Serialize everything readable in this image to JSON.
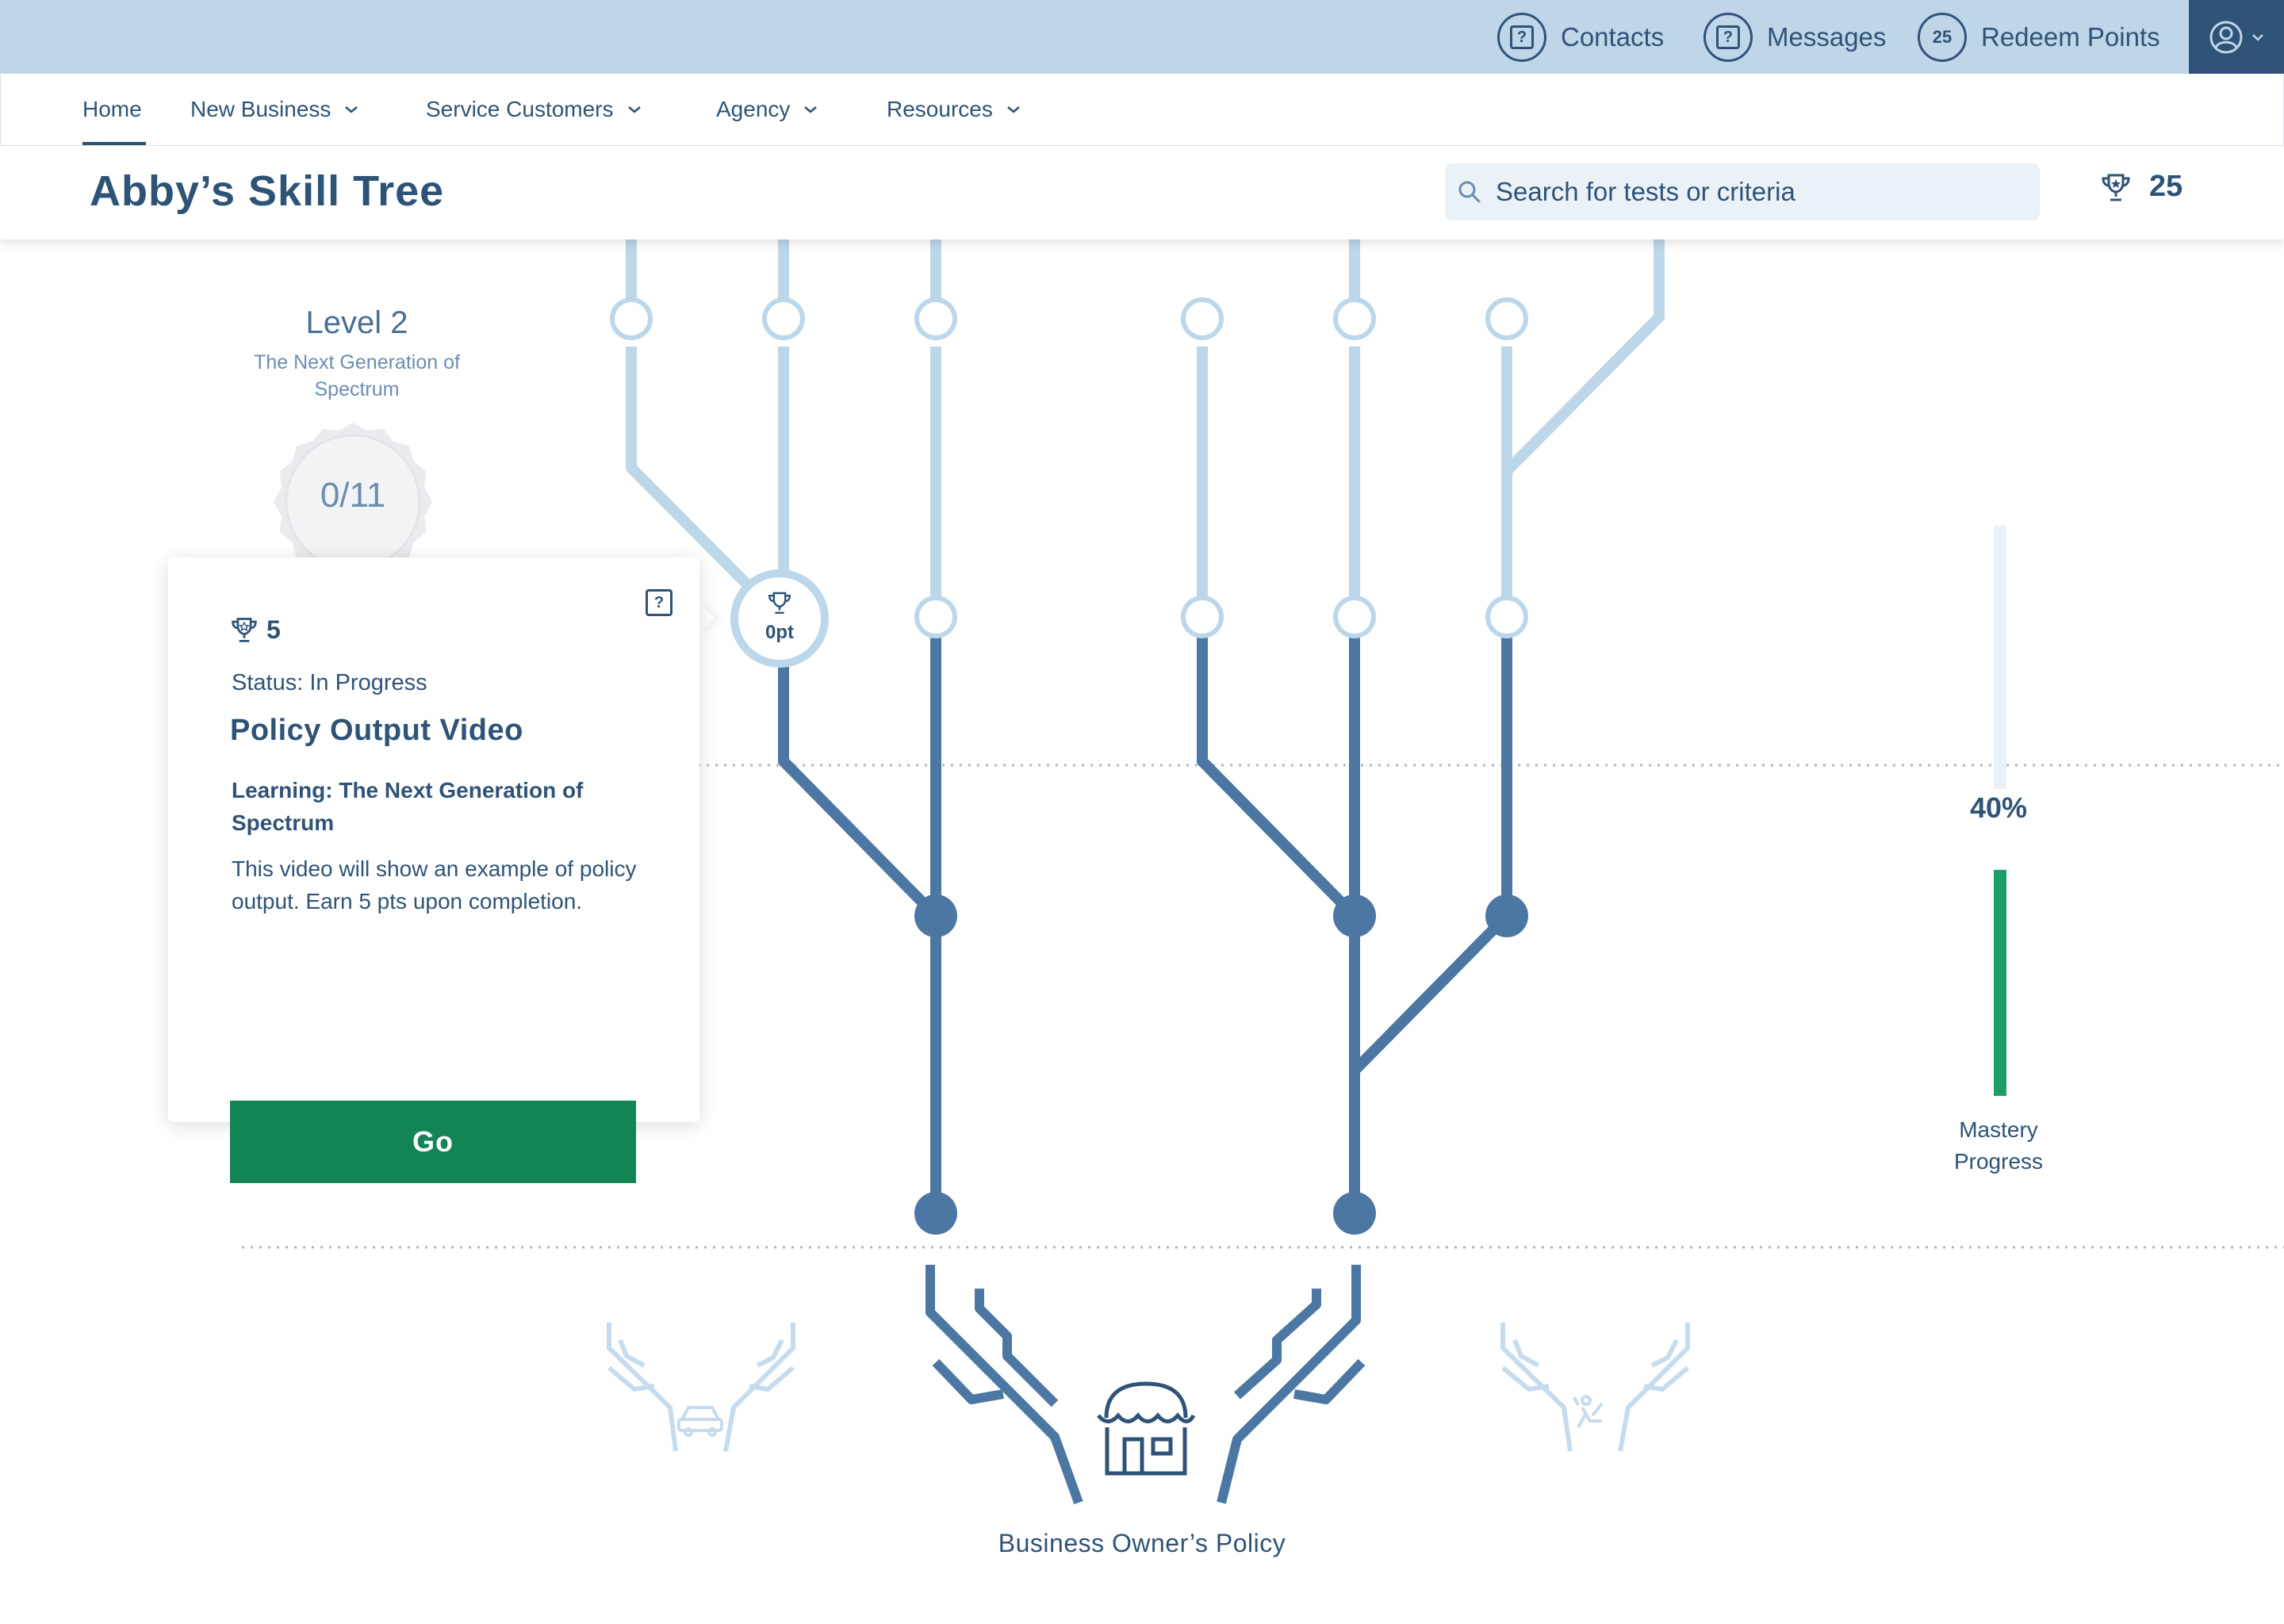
{
  "topbar": {
    "contacts_label": "Contacts",
    "messages_label": "Messages",
    "redeem_points_label": "Redeem Points",
    "points_badge": "25"
  },
  "nav": {
    "items": [
      "Home",
      "New Business",
      "Service Customers",
      "Agency",
      "Resources"
    ],
    "active": "Home"
  },
  "header": {
    "title": "Abby’s Skill Tree",
    "search_placeholder": "Search for tests or criteria",
    "trophy_points": "25"
  },
  "level": {
    "title": "Level 2",
    "subtitle": "The Next Generation  of Spectrum",
    "progress": "0/11"
  },
  "selected_node": {
    "label": "0pt"
  },
  "card": {
    "points": "5",
    "status": "Status: In Progress",
    "title": "Policy Output Video",
    "learning": "Learning: The Next Generation of Spectrum",
    "description": "This video will show an example of policy output. Earn 5 pts upon completion.",
    "go_label": "Go"
  },
  "mastery": {
    "percent_label": "40%",
    "fraction": 0.4,
    "label": "Mastery Progress"
  },
  "roots": {
    "center_label": "Business Owner’s Policy"
  },
  "colors": {
    "topbar_bg": "#bfd6e8",
    "primary": "#2f5377",
    "branch_dark": "#4c77a3",
    "branch_light": "#bcd6ea",
    "go_button": "#138555",
    "progress_green": "#1a9e63"
  }
}
